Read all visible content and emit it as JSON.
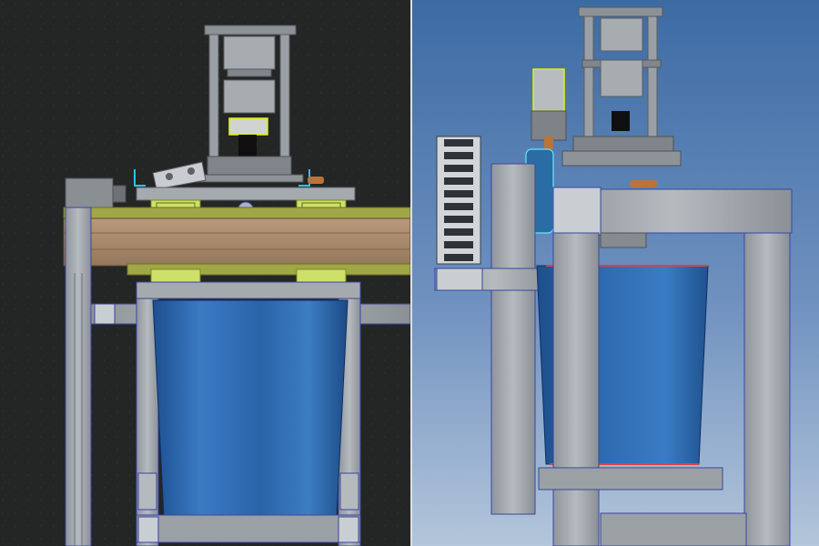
{
  "panels": [
    {
      "view": "front",
      "background": "dark-textured"
    },
    {
      "view": "side",
      "background": "blue-gradient"
    }
  ],
  "colors": {
    "frame": "#9ea3a8",
    "frame_edge": "#3a46a0",
    "bin_blue": "#2c68b0",
    "wood": "#a98a6a",
    "bracket_green": "#c7e14a",
    "highlight_yellow": "#e8f000",
    "copper": "#b8743a",
    "dark_bg": "#232424",
    "sky_top": "#3f6ea6",
    "sky_bottom": "#a9bfd8"
  }
}
